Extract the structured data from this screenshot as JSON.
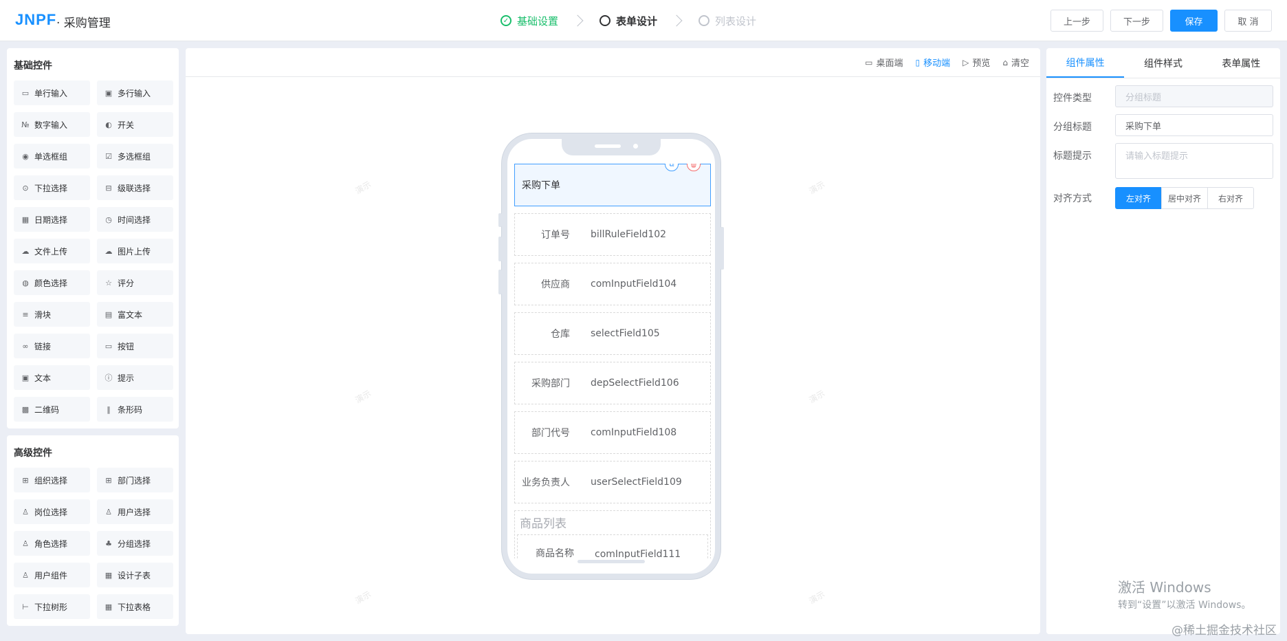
{
  "header": {
    "logo": "JNPF",
    "app_title": "· 采购管理",
    "steps": [
      {
        "label": "基础设置",
        "state": "done"
      },
      {
        "label": "表单设计",
        "state": "active"
      },
      {
        "label": "列表设计",
        "state": "pending"
      }
    ],
    "buttons": {
      "prev": "上一步",
      "next": "下一步",
      "save": "保存",
      "cancel": "取 消"
    }
  },
  "left": {
    "basic_title": "基础控件",
    "basic_items": [
      {
        "label": "单行输入",
        "icon": "input-icon"
      },
      {
        "label": "多行输入",
        "icon": "textarea-icon"
      },
      {
        "label": "数字输入",
        "icon": "number-icon"
      },
      {
        "label": "开关",
        "icon": "switch-icon"
      },
      {
        "label": "单选框组",
        "icon": "radio-icon"
      },
      {
        "label": "多选框组",
        "icon": "checkbox-icon"
      },
      {
        "label": "下拉选择",
        "icon": "select-icon"
      },
      {
        "label": "级联选择",
        "icon": "cascader-icon"
      },
      {
        "label": "日期选择",
        "icon": "date-icon"
      },
      {
        "label": "时间选择",
        "icon": "time-icon"
      },
      {
        "label": "文件上传",
        "icon": "upload-icon"
      },
      {
        "label": "图片上传",
        "icon": "image-upload-icon"
      },
      {
        "label": "颜色选择",
        "icon": "palette-icon"
      },
      {
        "label": "评分",
        "icon": "star-icon"
      },
      {
        "label": "滑块",
        "icon": "slider-icon"
      },
      {
        "label": "富文本",
        "icon": "richtext-icon"
      },
      {
        "label": "链接",
        "icon": "link-icon"
      },
      {
        "label": "按钮",
        "icon": "button-icon"
      },
      {
        "label": "文本",
        "icon": "text-icon"
      },
      {
        "label": "提示",
        "icon": "info-icon"
      },
      {
        "label": "二维码",
        "icon": "qrcode-icon"
      },
      {
        "label": "条形码",
        "icon": "barcode-icon"
      }
    ],
    "advanced_title": "高级控件",
    "advanced_items": [
      {
        "label": "组织选择",
        "icon": "org-icon"
      },
      {
        "label": "部门选择",
        "icon": "dept-icon"
      },
      {
        "label": "岗位选择",
        "icon": "position-icon"
      },
      {
        "label": "用户选择",
        "icon": "user-icon"
      },
      {
        "label": "角色选择",
        "icon": "role-icon"
      },
      {
        "label": "分组选择",
        "icon": "group-icon"
      },
      {
        "label": "用户组件",
        "icon": "user-component-icon"
      },
      {
        "label": "设计子表",
        "icon": "table-icon"
      },
      {
        "label": "下拉树形",
        "icon": "tree-icon"
      },
      {
        "label": "下拉表格",
        "icon": "grid-icon"
      }
    ]
  },
  "toolbar": {
    "desktop": "桌面端",
    "mobile": "移动端",
    "preview": "预览",
    "clear": "清空"
  },
  "canvas": {
    "watermark": "演示",
    "group_title": "采购下单",
    "fields": [
      {
        "label": "订单号",
        "value": "billRuleField102"
      },
      {
        "label": "供应商",
        "value": "comInputField104"
      },
      {
        "label": "仓库",
        "value": "selectField105"
      },
      {
        "label": "采购部门",
        "value": "depSelectField106"
      },
      {
        "label": "部门代号",
        "value": "comInputField108"
      },
      {
        "label": "业务负责人",
        "value": "userSelectField109"
      }
    ],
    "subtable": {
      "title": "商品列表",
      "field_label": "商品名称",
      "field_value": "comInputField111"
    }
  },
  "right": {
    "tabs": [
      "组件属性",
      "组件样式",
      "表单属性"
    ],
    "props": {
      "type_label": "控件类型",
      "type_value": "分组标题",
      "title_label": "分组标题",
      "title_value": "采购下单",
      "tip_label": "标题提示",
      "tip_placeholder": "请输入标题提示",
      "align_label": "对齐方式",
      "align_options": [
        "左对齐",
        "居中对齐",
        "右对齐"
      ]
    }
  },
  "os": {
    "activate_title": "激活 Windows",
    "activate_sub": "转到“设置”以激活 Windows。",
    "site": "@稀土掘金技术社区"
  },
  "colors": {
    "primary": "#1890ff",
    "success": "#19be6b",
    "danger": "#f56c6c"
  }
}
